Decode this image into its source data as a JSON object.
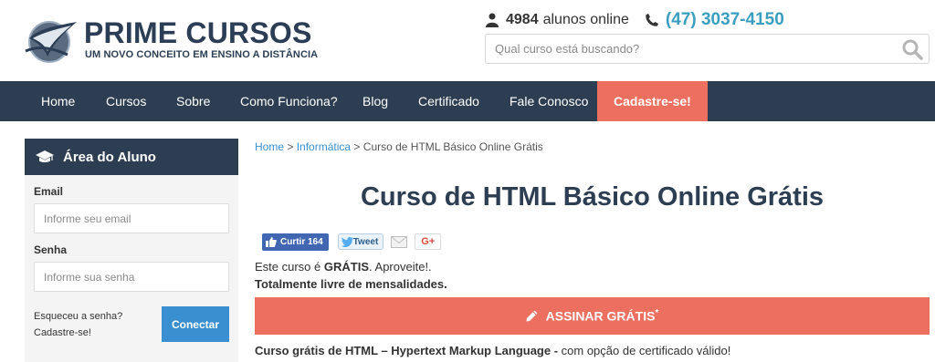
{
  "brand": {
    "name": "PRIME CURSOS",
    "tagline": "UM NOVO CONCEITO EM ENSINO A DISTÂNCIA"
  },
  "header": {
    "online_count": "4984",
    "online_text": "alunos online",
    "phone": "(47) 3037-4150",
    "search_placeholder": "Qual curso está buscando?"
  },
  "nav": {
    "items": [
      "Home",
      "Cursos",
      "Sobre",
      "Como Funciona?",
      "Blog",
      "Certificado",
      "Fale Conosco"
    ],
    "cta": "Cadastre-se!"
  },
  "sidebar": {
    "title": "Área do Aluno",
    "email_label": "Email",
    "email_placeholder": "Informe seu email",
    "password_label": "Senha",
    "password_placeholder": "Informe sua senha",
    "forgot": "Esqueceu a senha?",
    "register": "Cadastre-se!",
    "connect": "Conectar"
  },
  "breadcrumb": {
    "home": "Home",
    "sep": ">",
    "category": "Informática",
    "current": "Curso de HTML Básico Online Grátis"
  },
  "main": {
    "title": "Curso de HTML Básico Online Grátis",
    "social": {
      "like": "Curtir 164",
      "tweet": "Tweet",
      "gplus": "G+"
    },
    "intro_prefix": "Este curso é",
    "intro_bold": "GRÁTIS",
    "intro_suffix": ". Aproveite!.",
    "intro_line2": "Totalmente livre de mensalidades.",
    "subscribe_label": "ASSINAR GRÁTIS",
    "subscribe_mark": "*",
    "desc_bold": "Curso grátis de HTML – Hypertext Markup Language -",
    "desc_rest": " com opção de certificado válido!"
  },
  "colors": {
    "navy": "#2d3e52",
    "coral": "#ec6f5f",
    "blue": "#3a8fd0",
    "teal": "#3a9fbf"
  },
  "icons": [
    "logo-mark",
    "user-icon",
    "phone-icon",
    "search-icon",
    "graduation-cap-icon",
    "thumbs-up-icon",
    "twitter-bird-icon",
    "mail-icon",
    "pencil-icon"
  ]
}
